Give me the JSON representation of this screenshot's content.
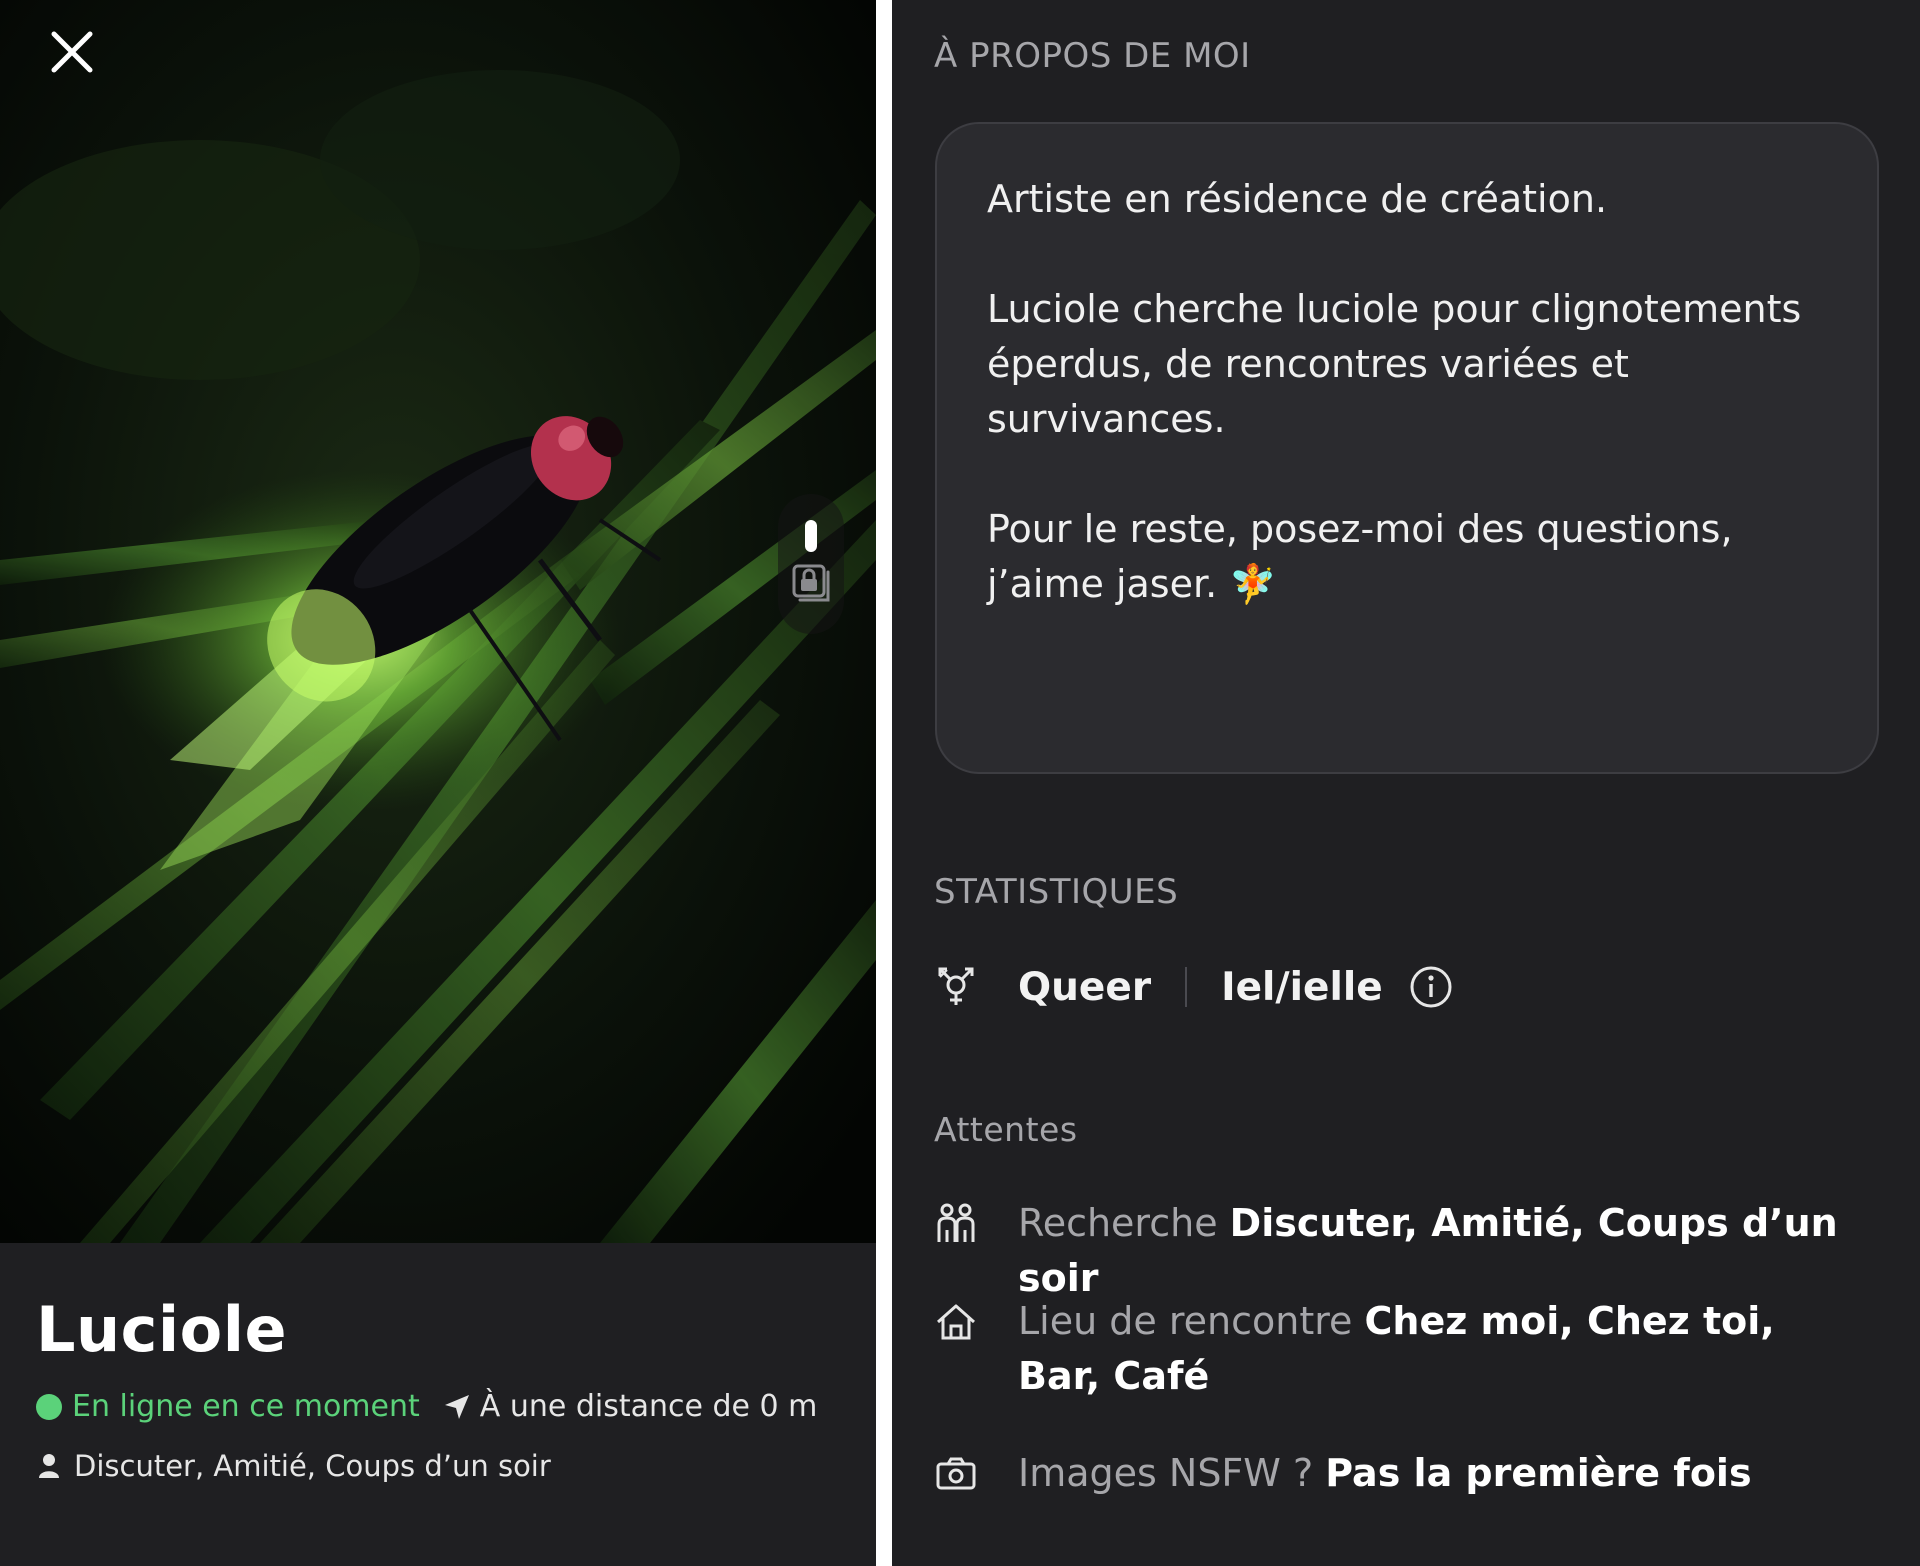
{
  "profile": {
    "name": "Luciole",
    "online_status": "En ligne en ce moment",
    "distance": "À une distance de 0 m",
    "looking_for_summary": "Discuter, Amitié, Coups d’un soir"
  },
  "icons": {
    "close": "close-icon",
    "gallery_lock": "lock-gallery-icon",
    "navigation": "navigation-arrow-icon",
    "person": "person-icon",
    "gender": "transgender-symbol-icon",
    "info": "info-icon",
    "people": "people-icon",
    "home": "home-icon",
    "camera": "camera-icon"
  },
  "colors": {
    "online": "#5bd27a",
    "background": "#1f1f22",
    "card": "#2b2b2f",
    "muted_text": "#a6a6aa"
  },
  "about": {
    "title": "À PROPOS DE MOI",
    "text": "Artiste en résidence de création.\n\nLuciole cherche luciole pour clignotements éperdus, de rencontres variées et survivances.\n\nPour le reste, posez-moi des questions, j’aime jaser. 🧚"
  },
  "stats": {
    "title": "STATISTIQUES",
    "identity": "Queer",
    "pronouns": "Iel/ielle"
  },
  "expectations": {
    "title": "Attentes",
    "looking_label": "Recherche",
    "looking_value": "Discuter, Amitié, Coups d’un soir",
    "place_label": "Lieu de rencontre",
    "place_value": "Chez moi, Chez toi, Bar, Café",
    "nsfw_label": "Images NSFW ?",
    "nsfw_value": "Pas la première fois"
  }
}
